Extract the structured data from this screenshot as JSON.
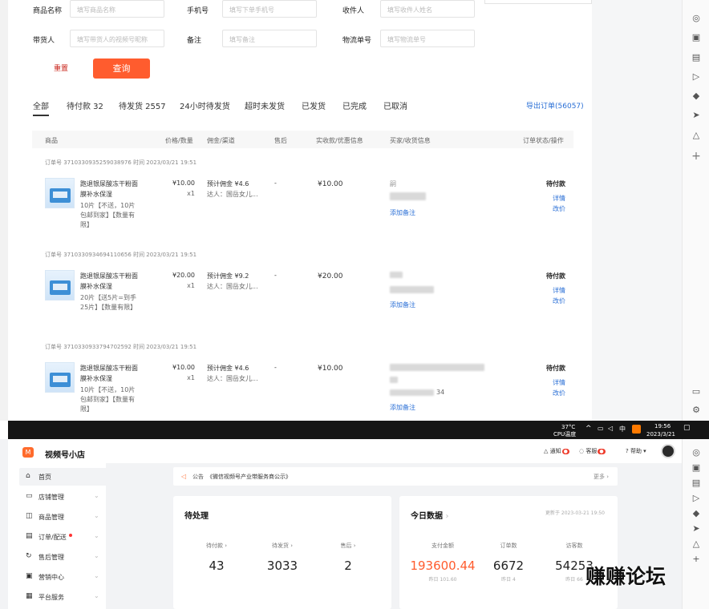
{
  "filters": {
    "product_label": "商品名称",
    "product_ph": "填写商品名称",
    "phone_label": "手机号",
    "phone_ph": "填写下单手机号",
    "receiver_label": "收件人",
    "receiver_ph": "填写收件人姓名",
    "seller_label": "带货人",
    "seller_ph": "填写带货人的视频号昵称",
    "remark_label": "备注",
    "remark_ph": "填写备注",
    "tracking_label": "物流单号",
    "tracking_ph": "填写物流单号",
    "reset": "重置",
    "query": "查询"
  },
  "tabs": [
    "全部",
    "待付款 32",
    "待发货 2557",
    "24小时待发货",
    "超时未发货",
    "已发货",
    "已完成",
    "已取消"
  ],
  "export": "导出订单(56057)",
  "table_headers": [
    "商品",
    "价格/数量",
    "佣金/渠道",
    "售后",
    "实收款/优惠信息",
    "买家/收货信息",
    "订单状态/操作"
  ],
  "orders": [
    {
      "head": "订单号 3710330935259038976   时间 2023/03/21 19:51",
      "name": "跑退银尿酸冻干粉面膜补水保湿",
      "sku": "10片【不送，10片包邮到家】【数量有限】",
      "price": "¥10.00",
      "qty": "x1",
      "commission": "预计佣金 ¥4.6",
      "channel": "达人：国岳女儿...",
      "aftersale": "-",
      "paid": "¥10.00",
      "buyer": "嗣",
      "note": "添加备注",
      "status": "待付款",
      "op1": "详情",
      "op2": "改价"
    },
    {
      "head": "订单号 3710330934694110656   时间 2023/03/21 19:51",
      "name": "跑退银尿酸冻干粉面膜补水保湿",
      "sku": "20片【送5片=到手25片】【数量有限】",
      "price": "¥20.00",
      "qty": "x1",
      "commission": "预计佣金 ¥9.2",
      "channel": "达人：国岳女儿...",
      "aftersale": "-",
      "paid": "¥20.00",
      "buyer": "",
      "note": "添加备注",
      "status": "待付款",
      "op1": "详情",
      "op2": "改价"
    },
    {
      "head": "订单号 3710330933794702592   时间 2023/03/21 19:51",
      "name": "跑退银尿酸冻干粉面膜补水保湿",
      "sku": "10片【不送，10片包邮到家】【数量有限】",
      "price": "¥10.00",
      "qty": "x1",
      "commission": "预计佣金 ¥4.6",
      "channel": "达人：国岳女儿...",
      "aftersale": "-",
      "paid": "¥10.00",
      "buyer": "",
      "buyer_tail": "34",
      "note": "添加备注",
      "status": "待付款",
      "op1": "详情",
      "op2": "改价"
    }
  ],
  "taskbar": {
    "temp": "37°C",
    "cpu": "CPU温度",
    "ime": "中",
    "time": "19:56",
    "date": "2023/3/21"
  },
  "dashboard": {
    "shop_name": "视频号小店",
    "nav": [
      "首页",
      "店铺管理",
      "商品管理",
      "订单/配送",
      "售后管理",
      "营销中心",
      "平台服务"
    ],
    "topnav": {
      "notice": "通知",
      "service": "客服",
      "help": "帮助"
    },
    "announcement_tag": "公告",
    "announcement": "《微信视频号产业带服务商公示》",
    "more": "更多",
    "pending": {
      "title": "待处理",
      "items": [
        {
          "label": "待付款",
          "value": "43"
        },
        {
          "label": "待发货",
          "value": "3033"
        },
        {
          "label": "售后",
          "value": "2"
        }
      ]
    },
    "today": {
      "title": "今日数据",
      "updated": "更新于 2023-03-21 19:50",
      "items": [
        {
          "label": "支付金额",
          "value": "193600.44",
          "sub": "昨日 101.60"
        },
        {
          "label": "订单数",
          "value": "6672",
          "sub": "昨日 4"
        },
        {
          "label": "访客数",
          "value": "54253",
          "sub": "昨日 66"
        }
      ]
    },
    "accent": "#ff5c2e"
  },
  "watermark": "赚赚论坛"
}
